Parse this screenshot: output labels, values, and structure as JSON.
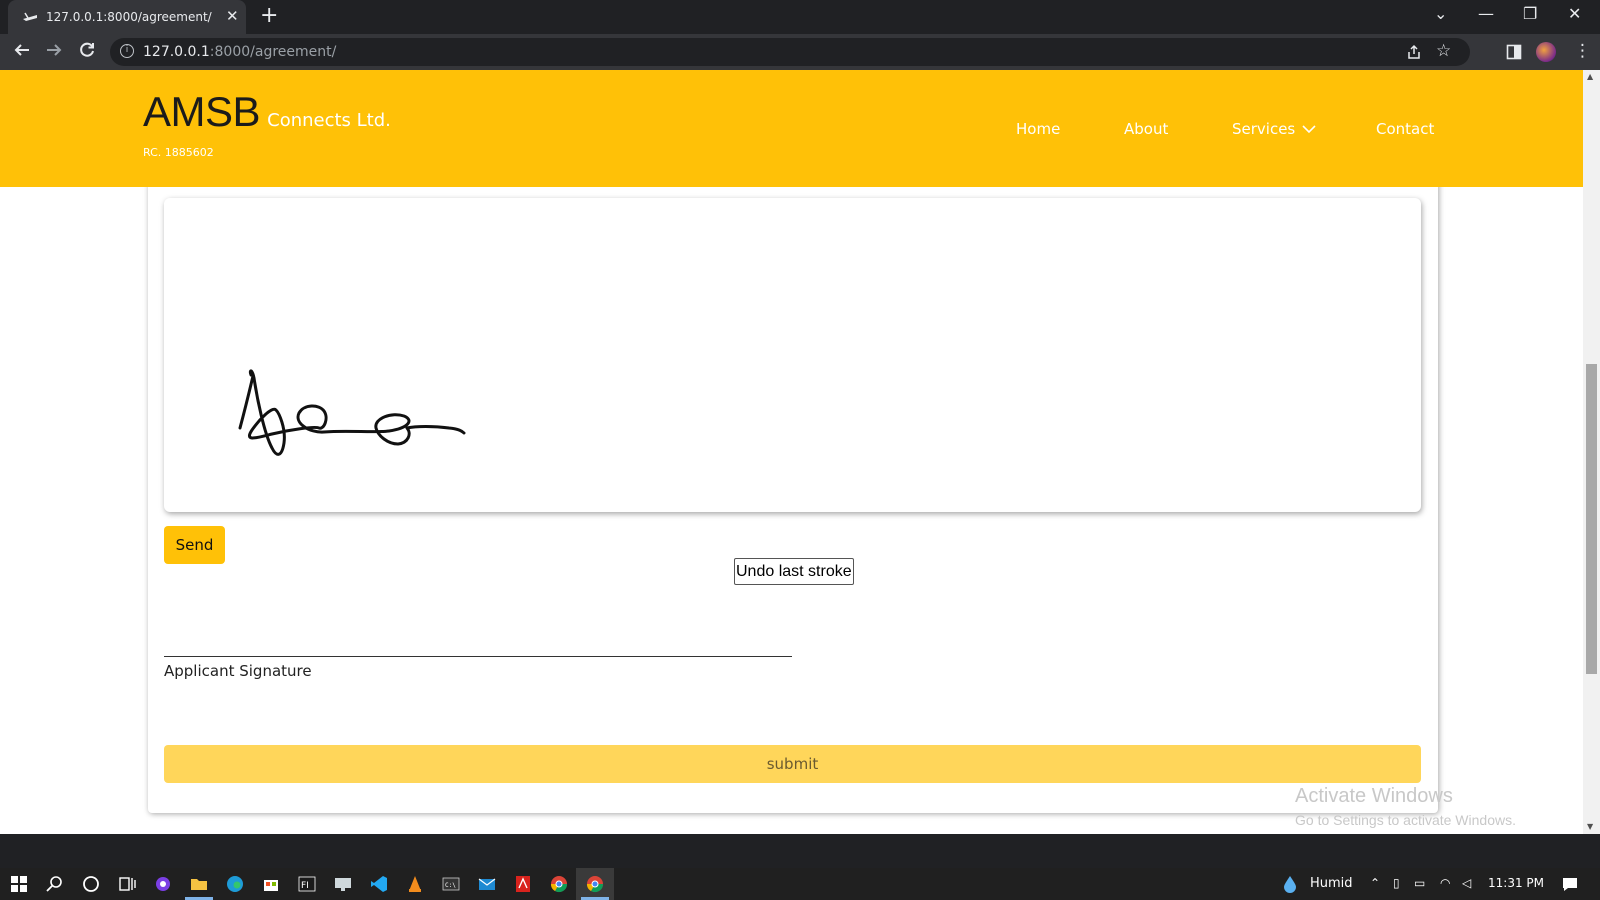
{
  "browser": {
    "tab_title": "127.0.0.1:8000/agreement/",
    "tab_close": "✕",
    "new_tab": "+",
    "url_host": "127.0.0.1",
    "url_path": ":8000/agreement/",
    "window_controls": [
      "⌄",
      "—",
      "❐",
      "✕"
    ]
  },
  "header": {
    "brand_main": "AMSB",
    "brand_sub": "Connects Ltd.",
    "rc": "RC. 1885602",
    "nav": [
      {
        "label": "Home"
      },
      {
        "label": "About"
      },
      {
        "label": "Services"
      },
      {
        "label": "Contact"
      }
    ],
    "colors": {
      "brand": "#ffc107"
    }
  },
  "form": {
    "undo_label": "Undo last stroke",
    "send_label": "Send",
    "signature_label": "Applicant Signature",
    "submit_label": "submit"
  },
  "watermark": {
    "line1": "Activate Windows",
    "line2": "Go to Settings to activate Windows."
  },
  "taskbar": {
    "weather": "Humid",
    "time": "11:31 PM"
  }
}
